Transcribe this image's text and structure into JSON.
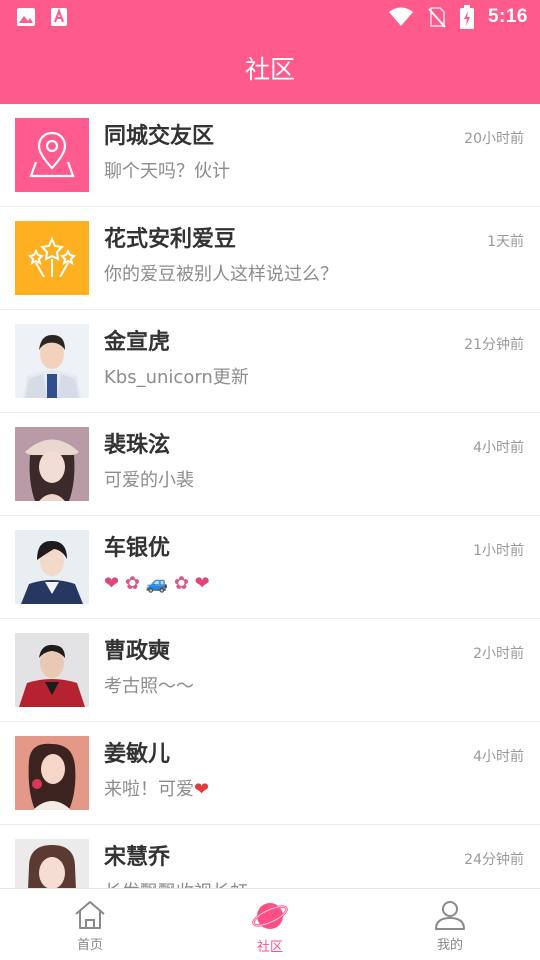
{
  "status_bar": {
    "time": "5:16"
  },
  "header": {
    "title": "社区"
  },
  "conversations": [
    {
      "name": "同城交友区",
      "preview": "聊个天吗？伙计",
      "time": "20小时前",
      "icon": "location-map-icon",
      "color": "#ff5b91"
    },
    {
      "name": "花式安利爱豆",
      "preview": "你的爱豆被别人这样说过么？",
      "time": "1天前",
      "icon": "sparkle-stars-icon",
      "color": "#ffb020"
    },
    {
      "name": "金宣虎",
      "preview": "Kbs_unicorn更新",
      "time": "21分钟前",
      "icon": "avatar-photo"
    },
    {
      "name": "裴珠泫",
      "preview": "可爱的小裴",
      "time": "4小时前",
      "icon": "avatar-photo"
    },
    {
      "name": "车银优",
      "preview_emoji": [
        "❤",
        "✿",
        "🚙",
        "✿",
        "❤"
      ],
      "time": "1小时前",
      "icon": "avatar-photo"
    },
    {
      "name": "曹政奭",
      "preview": "考古照～～",
      "time": "2小时前",
      "icon": "avatar-photo"
    },
    {
      "name": "姜敏儿",
      "preview": "来啦！可爱",
      "preview_suffix_emoji": "❤",
      "time": "4小时前",
      "icon": "avatar-photo"
    },
    {
      "name": "宋慧乔",
      "preview": "长发飘飘收视长虹",
      "time": "24分钟前",
      "icon": "avatar-photo"
    }
  ],
  "tabs": [
    {
      "label": "首页",
      "icon": "home-icon",
      "active": false
    },
    {
      "label": "社区",
      "icon": "planet-icon",
      "active": true
    },
    {
      "label": "我的",
      "icon": "user-icon",
      "active": false
    }
  ],
  "colors": {
    "accent": "#ff5a8c",
    "active_tab": "#ff4f87"
  }
}
